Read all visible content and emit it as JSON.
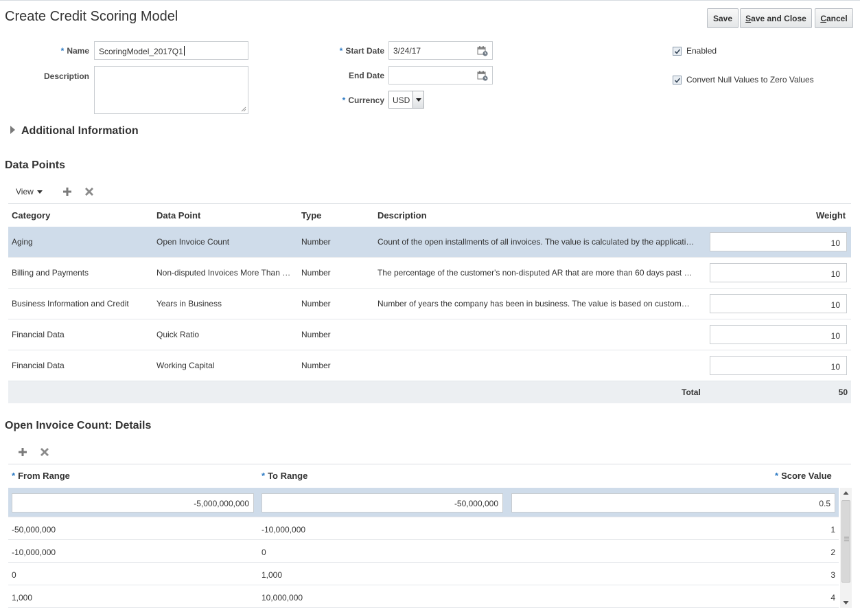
{
  "page": {
    "title": "Create Credit Scoring Model"
  },
  "toolbar": {
    "save_label": "Save",
    "save_close_prefix": "S",
    "save_close_rest": "ave and Close",
    "cancel_prefix": "C",
    "cancel_rest": "ancel"
  },
  "form": {
    "required_mark": "*",
    "name_label": "Name",
    "name_value": "ScoringModel_2017Q1",
    "description_label": "Description",
    "description_value": "",
    "start_date_label": "Start Date",
    "start_date_value": "3/24/17",
    "end_date_label": "End Date",
    "end_date_value": "",
    "currency_label": "Currency",
    "currency_value": "USD",
    "enabled_label": "Enabled",
    "enabled_checked": true,
    "convert_null_label": "Convert Null Values to Zero Values",
    "convert_null_checked": true
  },
  "additional_info": {
    "title": "Additional Information"
  },
  "data_points": {
    "title": "Data Points",
    "view_label": "View",
    "columns": {
      "category": "Category",
      "data_point": "Data Point",
      "type": "Type",
      "description": "Description",
      "weight": "Weight"
    },
    "rows": [
      {
        "category": "Aging",
        "data_point": "Open Invoice Count",
        "type": "Number",
        "description": "Count of the open installments of all invoices. The value is calculated by the applicati…",
        "weight": "10"
      },
      {
        "category": "Billing and Payments",
        "data_point": "Non-disputed Invoices More Than …",
        "type": "Number",
        "description": "The percentage of the customer's non-disputed AR that are more than 60 days past …",
        "weight": "10"
      },
      {
        "category": "Business Information and Credit",
        "data_point": "Years in Business",
        "type": "Number",
        "description": "Number of years the company has been in business. The value is based on custom…",
        "weight": "10"
      },
      {
        "category": "Financial Data",
        "data_point": "Quick Ratio",
        "type": "Number",
        "description": "",
        "weight": "10"
      },
      {
        "category": "Financial Data",
        "data_point": "Working Capital",
        "type": "Number",
        "description": "",
        "weight": "10"
      }
    ],
    "total_label": "Total",
    "total_value": "50"
  },
  "details": {
    "title": "Open Invoice Count: Details",
    "columns": {
      "from_range": "From Range",
      "to_range": "To Range",
      "score_value": "Score Value"
    },
    "rows": [
      {
        "from": "-5,000,000,000",
        "to": "-50,000,000",
        "score": "0.5"
      },
      {
        "from": "-50,000,000",
        "to": "-10,000,000",
        "score": "1"
      },
      {
        "from": "-10,000,000",
        "to": "0",
        "score": "2"
      },
      {
        "from": "0",
        "to": "1,000",
        "score": "3"
      },
      {
        "from": "1,000",
        "to": "10,000,000",
        "score": "4"
      }
    ]
  },
  "colors": {
    "selected_row": "#cfdcea",
    "required_asterisk": "#2e7bc4"
  },
  "icons": {
    "add": "plus-icon",
    "delete": "x-icon",
    "calendar": "calendar-icon",
    "dropdown": "chevron-down-icon"
  }
}
